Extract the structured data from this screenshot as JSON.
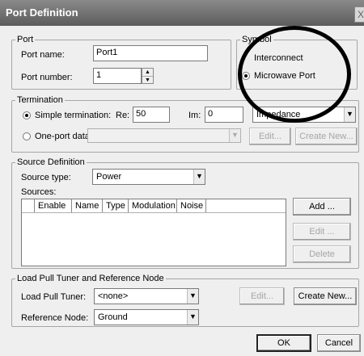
{
  "window": {
    "title": "Port Definition",
    "close_glyph": "X"
  },
  "port": {
    "legend": "Port",
    "name_label": "Port name:",
    "name_value": "Port1",
    "number_label": "Port number:",
    "number_value": "1"
  },
  "symbol": {
    "legend": "Symbol",
    "options": [
      "Interconnect",
      "Microwave Port"
    ],
    "selected": "Microwave Port"
  },
  "termination": {
    "legend": "Termination",
    "simple_label": "Simple termination:",
    "re_label": "Re:",
    "re_value": "50",
    "im_label": "Im:",
    "im_value": "0",
    "impedance_value": "Impedance",
    "oneport_label": "One-port data:",
    "oneport_value": "",
    "edit_label": "Edit...",
    "create_new_label": "Create New...",
    "selected": "Simple termination"
  },
  "source": {
    "legend": "Source Definition",
    "type_label": "Source type:",
    "type_value": "Power",
    "sources_label": "Sources:",
    "columns": [
      "Enable",
      "Name",
      "Type",
      "Modulation",
      "Noise"
    ],
    "add_label": "Add ...",
    "edit_label": "Edit ...",
    "delete_label": "Delete"
  },
  "loadpull": {
    "legend": "Load Pull Tuner and Reference Node",
    "tuner_label": "Load Pull Tuner:",
    "tuner_value": "<none>",
    "refnode_label": "Reference Node:",
    "refnode_value": "Ground",
    "edit_label": "Edit...",
    "create_new_label": "Create New..."
  },
  "buttons": {
    "ok": "OK",
    "cancel": "Cancel"
  }
}
